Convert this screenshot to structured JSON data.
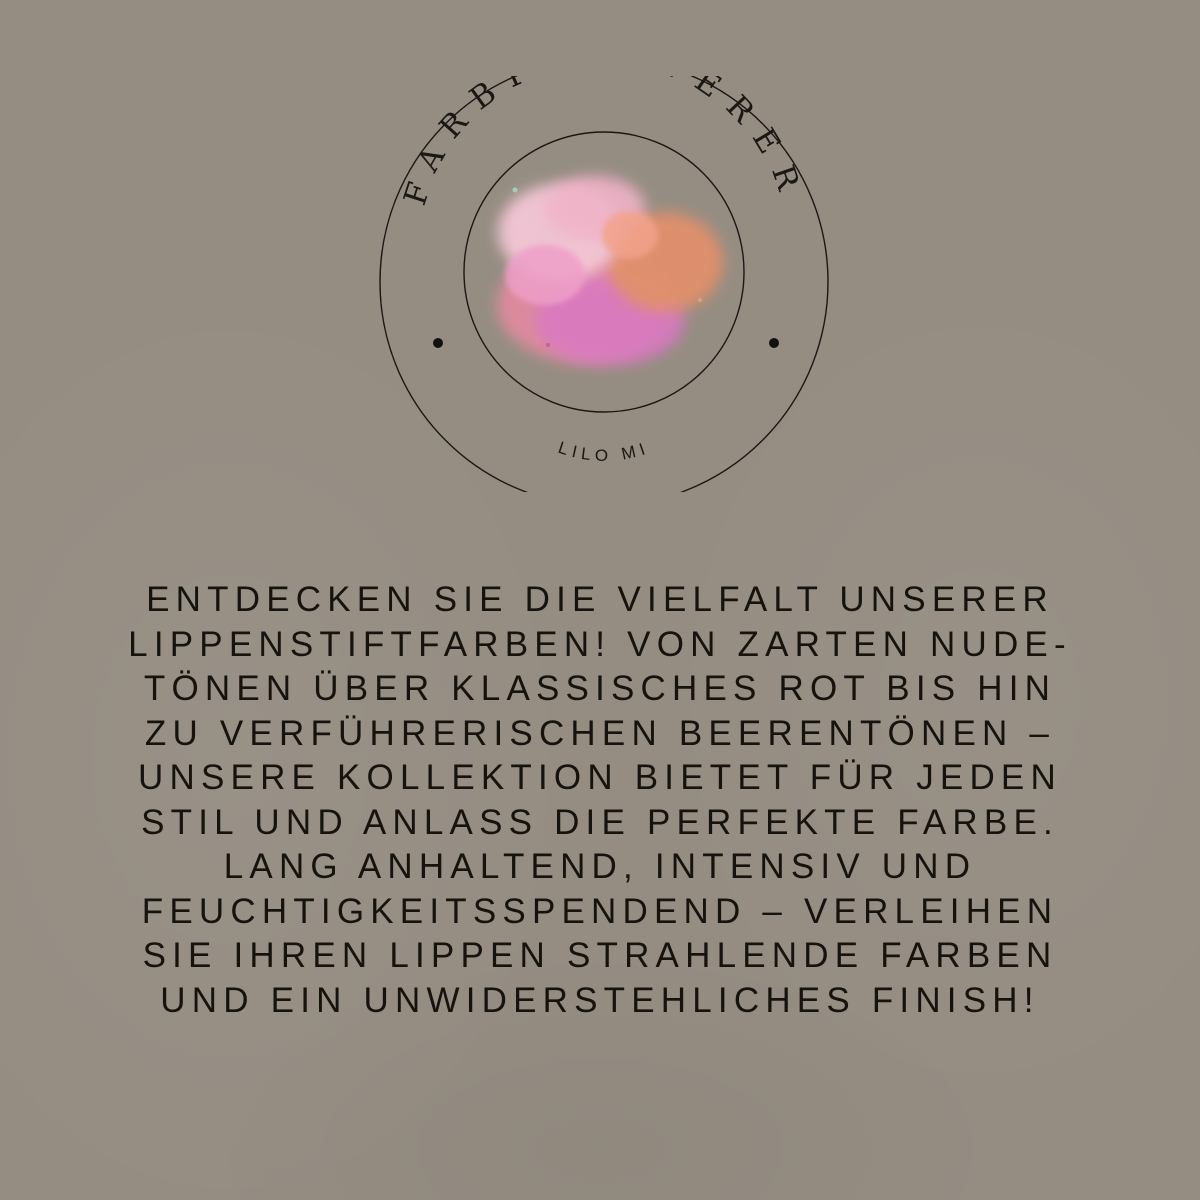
{
  "logo": {
    "brand_name": "FARBFLÜSTERER",
    "brand_subtitle": "LILO MI",
    "ink_color": "#1a1714",
    "splash_colors": [
      "#f4c6d6",
      "#ee9fc8",
      "#e88aa2",
      "#e1906c",
      "#d978c3"
    ]
  },
  "body": {
    "lines": [
      "ENTDECKEN SIE DIE VIELFALT UNSERER",
      "LIPPENSTIFTFARBEN! VON ZARTEN NUDE-",
      "TÖNEN ÜBER KLASSISCHES ROT BIS HIN",
      "ZU VERFÜHRERISCHEN BEERENTÖNEN –",
      "UNSERE KOLLEKTION BIETET FÜR JEDEN",
      "STIL UND ANLASS DIE PERFEKTE FARBE.",
      "LANG ANHALTEND, INTENSIV UND",
      "FEUCHTIGKEITSSPENDEND – VERLEIHEN",
      "SIE IHREN LIPPEN STRAHLENDE FARBEN",
      "UND EIN UNWIDERSTEHLICHES FINISH!"
    ]
  },
  "background_color": "#958d82"
}
